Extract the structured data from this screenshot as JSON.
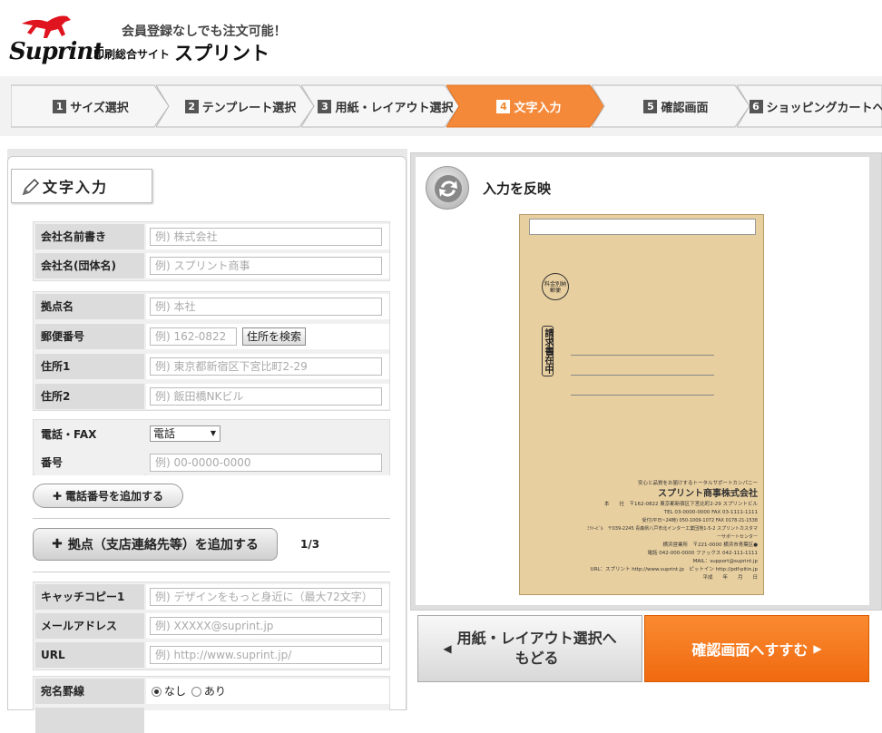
{
  "header": {
    "logo_text": "Suprint",
    "tagline": "会員登録なしでも注文可能！",
    "site_sub": "印刷総合サイト",
    "site_name": "スプリント"
  },
  "steps": [
    {
      "num": "1",
      "label": "サイズ選択"
    },
    {
      "num": "2",
      "label": "テンプレート選択"
    },
    {
      "num": "3",
      "label": "用紙・レイアウト選択"
    },
    {
      "num": "4",
      "label": "文字入力"
    },
    {
      "num": "5",
      "label": "確認画面"
    },
    {
      "num": "6",
      "label": "ショッピングカートへ"
    }
  ],
  "colors": {
    "accent": "#f08a30",
    "active_step": "#f5893a"
  },
  "form": {
    "panel_title": "文字入力",
    "company_prefix_label": "会社名前書き",
    "company_prefix_ph": "例) 株式会社",
    "company_name_label": "会社名(団体名)",
    "company_name_ph": "例) スプリント商事",
    "branch_label": "拠点名",
    "branch_ph": "例) 本社",
    "postal_label": "郵便番号",
    "postal_ph": "例) 162-0822",
    "address_search": "住所を検索",
    "address1_label": "住所1",
    "address1_ph": "例) 東京都新宿区下宮比町2-29",
    "address2_label": "住所2",
    "address2_ph": "例) 飯田橋NKビル",
    "phone_fax_label": "電話・FAX",
    "phone_type_value": "電話",
    "number_label": "番号",
    "number_ph": "例) 00-0000-0000",
    "add_phone": "電話番号を追加する",
    "add_branch": "拠点（支店連絡先等）を追加する",
    "branch_count": "1/3",
    "catch_label": "キャッチコピー1",
    "catch_ph": "例) デザインをもっと身近に（最大72文字）",
    "email_label": "メールアドレス",
    "email_ph": "例) XXXXX@suprint.jp",
    "url_label": "URL",
    "url_ph": "例) http://www.suprint.jp/",
    "address_rule_label": "宛名罫線",
    "rule_none": "なし",
    "rule_yes": "あり"
  },
  "preview": {
    "reflect_label": "入力を反映",
    "stamp_text": "料金別納郵便",
    "req_text": "請求書在中",
    "tagline": "安心と品質をお届けするトータルサポートカンパニー",
    "company": "スプリント商事株式会社",
    "line1": "本　　社　〒162-0822 東京都新宿区下宮比町2-29 スプリントビル",
    "line2": "TEL 03-0000-0000 FAX 03-1111-1111",
    "line3": "受付(平日~24時) 050-1009-1072 FAX 0178-21-1538",
    "line4": "ﾐﾂﾄｰﾋﾞﾙ　〒039-2245 青森県八戸市北インター工業団地1-5-2 スプリントカスタマーサポートセンター",
    "line5": "横浜営業所　〒221-0000 横浜市青葉区●",
    "line6": "電話 042-000-0000 ファックス 042-111-1111",
    "line7": "MAIL：support@suprint.jp",
    "line8": "URL：スプリント http://www.suprint.jp　ピットイン http://pdf-pitin.jp",
    "line9": "平成　　年　　月　　日"
  },
  "nav": {
    "back_line1": "用紙・レイアウト選択へ",
    "back_line2": "もどる",
    "next": "確認画面へすすむ"
  }
}
